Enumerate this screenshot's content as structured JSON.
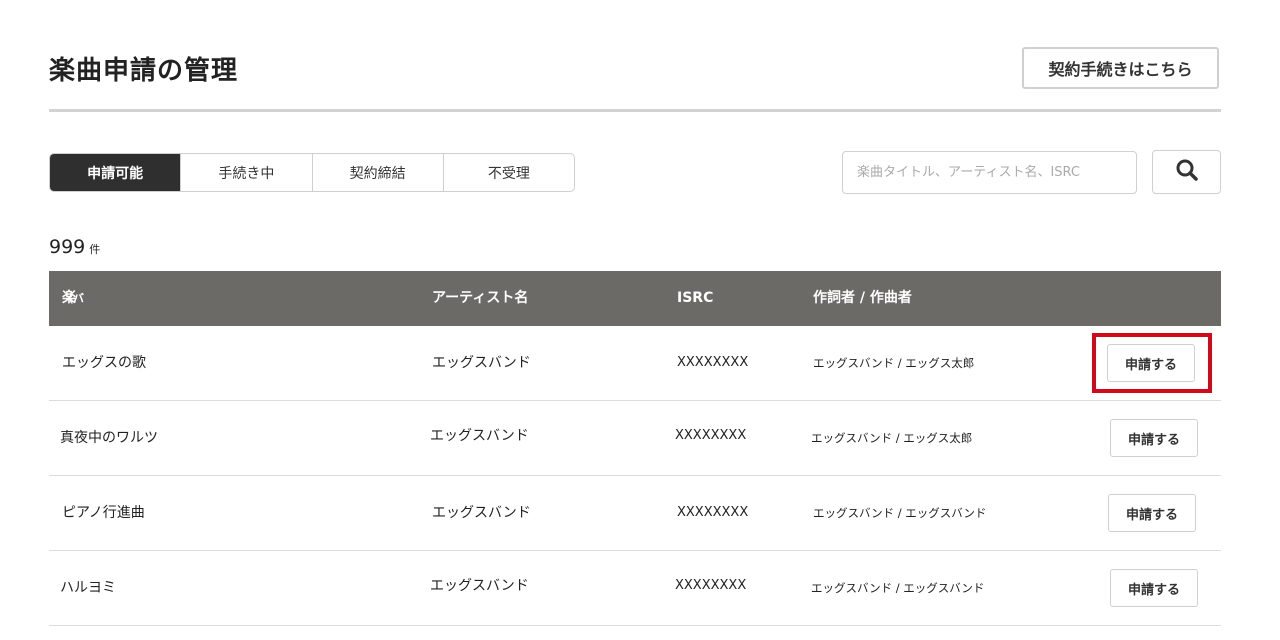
{
  "page": {
    "title": "楽曲申請の管理",
    "contract_button": "契約手続きはこちら"
  },
  "tabs": [
    {
      "label": "申請可能",
      "active": true
    },
    {
      "label": "手続き中",
      "active": false
    },
    {
      "label": "契約締結",
      "active": false
    },
    {
      "label": "不受理",
      "active": false
    }
  ],
  "search": {
    "placeholder": "楽曲タイトル、アーティスト名、ISRC",
    "icon": "search-icon"
  },
  "result": {
    "count": "999",
    "unit": "件"
  },
  "table": {
    "headers": {
      "title": "楽曲タイトル",
      "title_sub": "（バージョン名）",
      "artist": "アーティスト名",
      "isrc": "ISRC",
      "composer": "作詞者 / 作曲者"
    },
    "rows": [
      {
        "title": "エッグスの歌",
        "artist": "エッグスバンド",
        "isrc": "XXXXXXXX",
        "composer": "エッグスバンド / エッグス太郎",
        "action": "申請する"
      },
      {
        "title": "真夜中のワルツ",
        "artist": "エッグスバンド",
        "isrc": "XXXXXXXX",
        "composer": "エッグスバンド / エッグス太郎",
        "action": "申請する"
      },
      {
        "title": "ピアノ行進曲",
        "artist": "エッグスバンド",
        "isrc": "XXXXXXXX",
        "composer": "エッグスバンド / エッグスバンド",
        "action": "申請する"
      },
      {
        "title": "ハルヨミ",
        "artist": "エッグスバンド",
        "isrc": "XXXXXXXX",
        "composer": "エッグスバンド / エッグスバンド",
        "action": "申請する"
      }
    ]
  },
  "colors": {
    "active_tab": "#2f2f2f",
    "table_header": "#6c6a66",
    "highlight": "#d10a1a"
  }
}
